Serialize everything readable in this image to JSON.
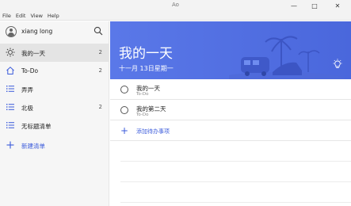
{
  "window": {
    "title": "Ao",
    "minimize": "—",
    "maximize": "□",
    "close": "✕"
  },
  "menu": [
    "File",
    "Edit",
    "View",
    "Help"
  ],
  "sidebar": {
    "user_name": "xiang long",
    "items": [
      {
        "label": "我的一天",
        "count": "2",
        "icon": "sun-icon"
      },
      {
        "label": "To-Do",
        "count": "2",
        "icon": "home-icon"
      },
      {
        "label": "弄弄",
        "count": "",
        "icon": "list-icon"
      },
      {
        "label": "北极",
        "count": "2",
        "icon": "list-icon"
      },
      {
        "label": "无标题清单",
        "count": "",
        "icon": "list-icon"
      }
    ],
    "new_list": "新建清单"
  },
  "banner": {
    "title": "我的一天",
    "date": "十一月 13日星期一"
  },
  "tasks": [
    {
      "title": "我的一天",
      "subtitle": "To-Do"
    },
    {
      "title": "我的第二天",
      "subtitle": "To-Do"
    }
  ],
  "add_task": "添加待办事项",
  "colors": {
    "accent": "#3b5bdb",
    "banner": "#5a78e8"
  }
}
